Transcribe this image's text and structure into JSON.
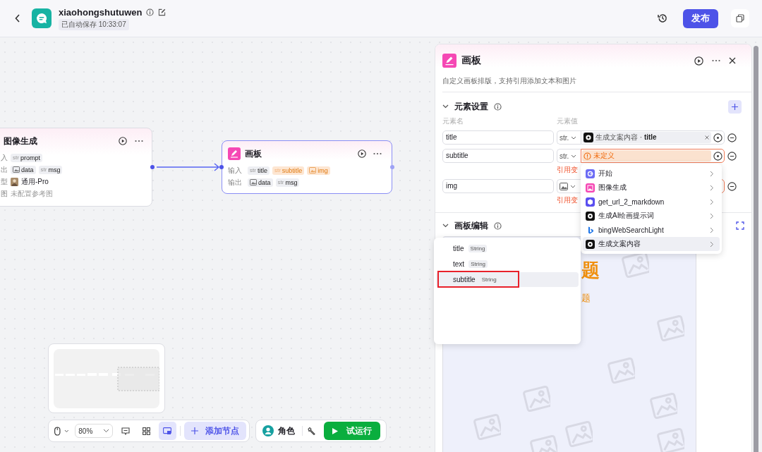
{
  "header": {
    "title": "xiaohongshutuwen",
    "autosave": "已自动保存 10:33:07",
    "publish": "发布"
  },
  "nodes": [
    {
      "title": "图像生成",
      "selected": false,
      "rows": [
        {
          "kind": "tags",
          "label": "入",
          "tags": [
            {
              "kind": "str",
              "prefix": "str",
              "name": "prompt",
              "warning": false
            }
          ]
        },
        {
          "kind": "tags",
          "label": "出",
          "tags": [
            {
              "kind": "image",
              "name": "data",
              "warning": false
            },
            {
              "kind": "str",
              "prefix": "str",
              "name": "msg",
              "warning": false
            }
          ]
        },
        {
          "kind": "model",
          "label": "型",
          "text": "通用-Pro"
        },
        {
          "kind": "muted",
          "label": "图",
          "text": "未配置参考图"
        }
      ]
    },
    {
      "title": "画板",
      "selected": true,
      "rows": [
        {
          "kind": "tags",
          "label": "输入",
          "tags": [
            {
              "kind": "str",
              "prefix": "str",
              "name": "title",
              "warning": false
            },
            {
              "kind": "str",
              "prefix": "str",
              "name": "subtitle",
              "warning": true
            },
            {
              "kind": "image",
              "name": "img",
              "warning": true
            }
          ]
        },
        {
          "kind": "tags",
          "label": "输出",
          "tags": [
            {
              "kind": "image",
              "name": "data",
              "warning": false
            },
            {
              "kind": "str",
              "prefix": "str",
              "name": "msg",
              "warning": false
            }
          ]
        }
      ]
    }
  ],
  "panel": {
    "title": "画板",
    "description": "自定义画板排版，支持引用添加文本和图片",
    "elements_section": {
      "title": "元素设置",
      "expanded": true,
      "name_header": "元素名",
      "value_header": "元素值",
      "elements": [
        {
          "name": "title",
          "type": {
            "kind": "str",
            "label": "str."
          },
          "value": {
            "kind": "ref",
            "text": "生成文案内容 · **title**"
          }
        },
        {
          "name": "subtitle",
          "type": {
            "kind": "str",
            "label": "str."
          },
          "value": {
            "kind": "undefined",
            "text": "未定义"
          },
          "error": "引用变"
        },
        {
          "name": "img",
          "type": {
            "kind": "image"
          },
          "value": {
            "kind": "hidden"
          },
          "error": "引用变"
        }
      ]
    },
    "canvas_section": {
      "title": "画板编辑",
      "expanded": true,
      "preview_title": "题",
      "preview_subtitle": "题"
    }
  },
  "node_menu": [
    {
      "label": "开始",
      "kind": "start",
      "selected": false
    },
    {
      "label": "图像生成",
      "kind": "image",
      "selected": false
    },
    {
      "label": "get_url_2_markdown",
      "kind": "plugin",
      "selected": false
    },
    {
      "label": "生成AI绘画提示词",
      "kind": "llm",
      "selected": false
    },
    {
      "label": "bingWebSearchLight",
      "kind": "search",
      "selected": false
    },
    {
      "label": "生成文案内容",
      "kind": "llm",
      "selected": true
    }
  ],
  "field_menu": [
    {
      "name": "title",
      "type": "String",
      "selected": false
    },
    {
      "name": "text",
      "type": "String",
      "selected": false
    },
    {
      "name": "subtitle",
      "type": "String",
      "selected": true
    }
  ],
  "toolbar": {
    "zoom": "80%",
    "tools": [
      {
        "kind": "comment",
        "selected": false
      },
      {
        "kind": "grid",
        "selected": false
      },
      {
        "kind": "minimap",
        "selected": true
      }
    ],
    "add_node": "添加节点",
    "role": "角色",
    "run": "试运行"
  }
}
